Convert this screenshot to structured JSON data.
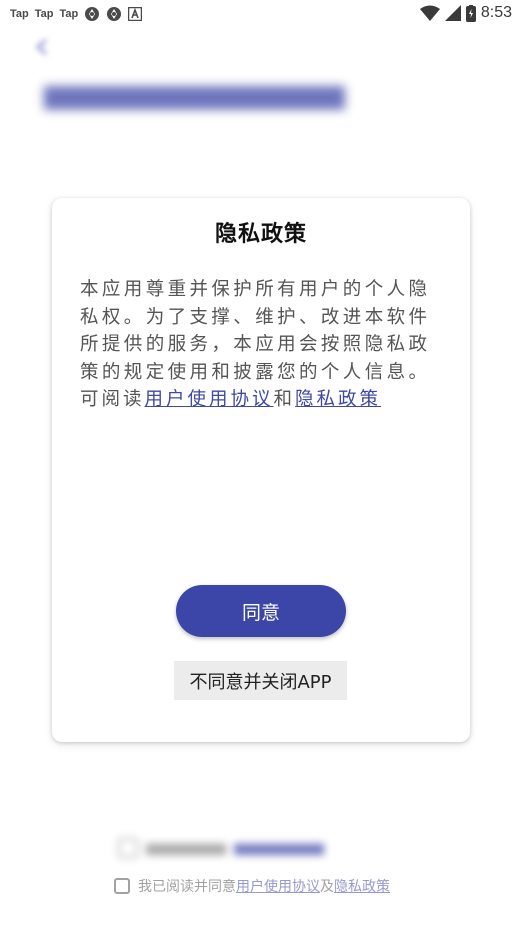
{
  "status_bar": {
    "notifications": [
      "Tap",
      "Tap",
      "Tap"
    ],
    "time": "8:53"
  },
  "dialog": {
    "title": "隐私政策",
    "body_text": "本应用尊重并保护所有用户的个人隐私权。为了支撑、维护、改进本软件所提供的服务，本应用会按照隐私政策的规定使用和披露您的个人信息。可阅读",
    "link_user_agreement": "用户使用协议",
    "conjunction": "和",
    "link_privacy_policy": "隐私政策",
    "agree_label": "同意",
    "decline_label": "不同意并关闭APP"
  },
  "footer": {
    "agree_prefix": "我已阅读并同意",
    "link_user_agreement": "用户使用协议",
    "conjunction": "及",
    "link_privacy_policy": "隐私政策"
  },
  "colors": {
    "accent": "#3c46a8",
    "link": "#3f48a8"
  }
}
